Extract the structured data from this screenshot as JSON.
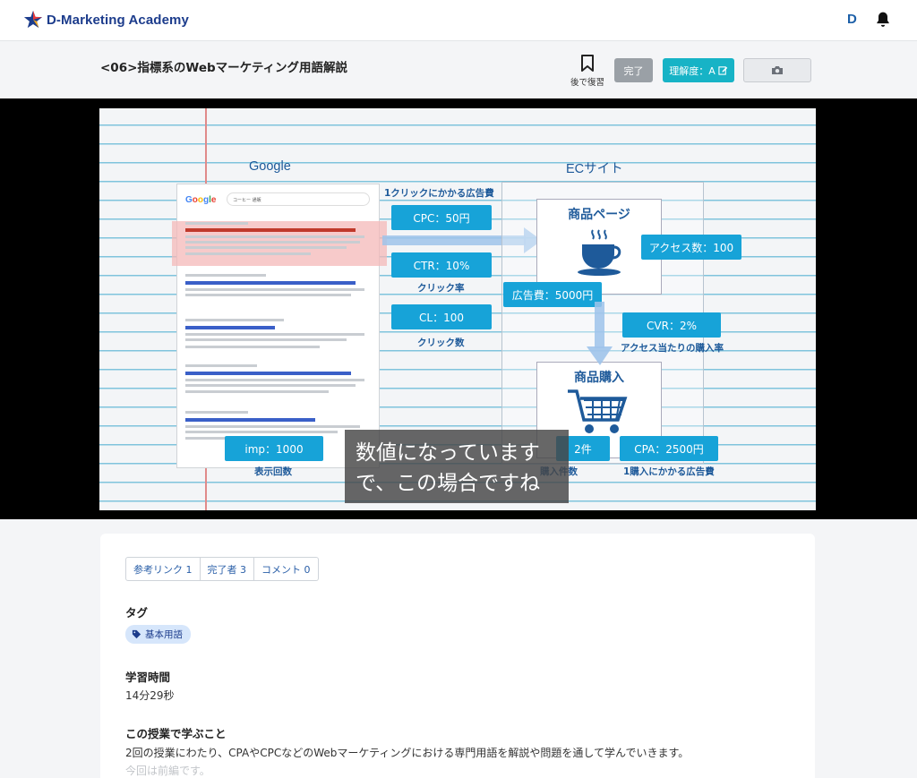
{
  "app": {
    "name": "D-Marketing Academy",
    "user_initial": "D"
  },
  "lesson": {
    "title": "<06>指標系のWebマーケティング用語解説",
    "review_later_label": "後で復習",
    "done_label": "完了",
    "understanding_label": "理解度：A"
  },
  "video": {
    "slide": {
      "google_title": "Google",
      "ec_title": "ECサイト",
      "search_query": "コーヒー 通販",
      "cost_per_click_caption": "1クリックにかかる広告費",
      "cpc": "CPC：50円",
      "ctr": "CTR：10%",
      "ctr_caption": "クリック率",
      "cl": "CL：100",
      "cl_caption": "クリック数",
      "imp": "imp：1000",
      "imp_caption": "表示回数",
      "product_page": "商品ページ",
      "access_count": "アクセス数：100",
      "ad_cost": "広告費：5000円",
      "cvr": "CVR：2%",
      "cvr_caption": "アクセス当たりの購入率",
      "purchase": "商品購入",
      "purchase_count": "2件",
      "purchase_caption": "購入件数",
      "cpa": "CPA：2500円",
      "cpa_caption": "1購入にかかる広告費"
    },
    "subtitle": {
      "line1": "数値になっています",
      "line2": "で、この場合ですね"
    }
  },
  "tabs": [
    {
      "label": "参考リンク 1"
    },
    {
      "label": "完了者 3"
    },
    {
      "label": "コメント 0"
    }
  ],
  "details": {
    "tags_title": "タグ",
    "tag": "基本用語",
    "study_time_title": "学習時間",
    "study_time": "14分29秒",
    "learn_title": "この授業で学ぶこと",
    "learn_text": "2回の授業にわたり、CPAやCPCなどのWebマーケティングにおける専門用語を解説や問題を通して学んでいきます。",
    "learn_text2": "今回は前編です。"
  },
  "colors": {
    "brand": "#1c3c8c",
    "accent": "#17b3c6",
    "metric": "#17a3d8",
    "done_button": "#9aa0a6"
  }
}
